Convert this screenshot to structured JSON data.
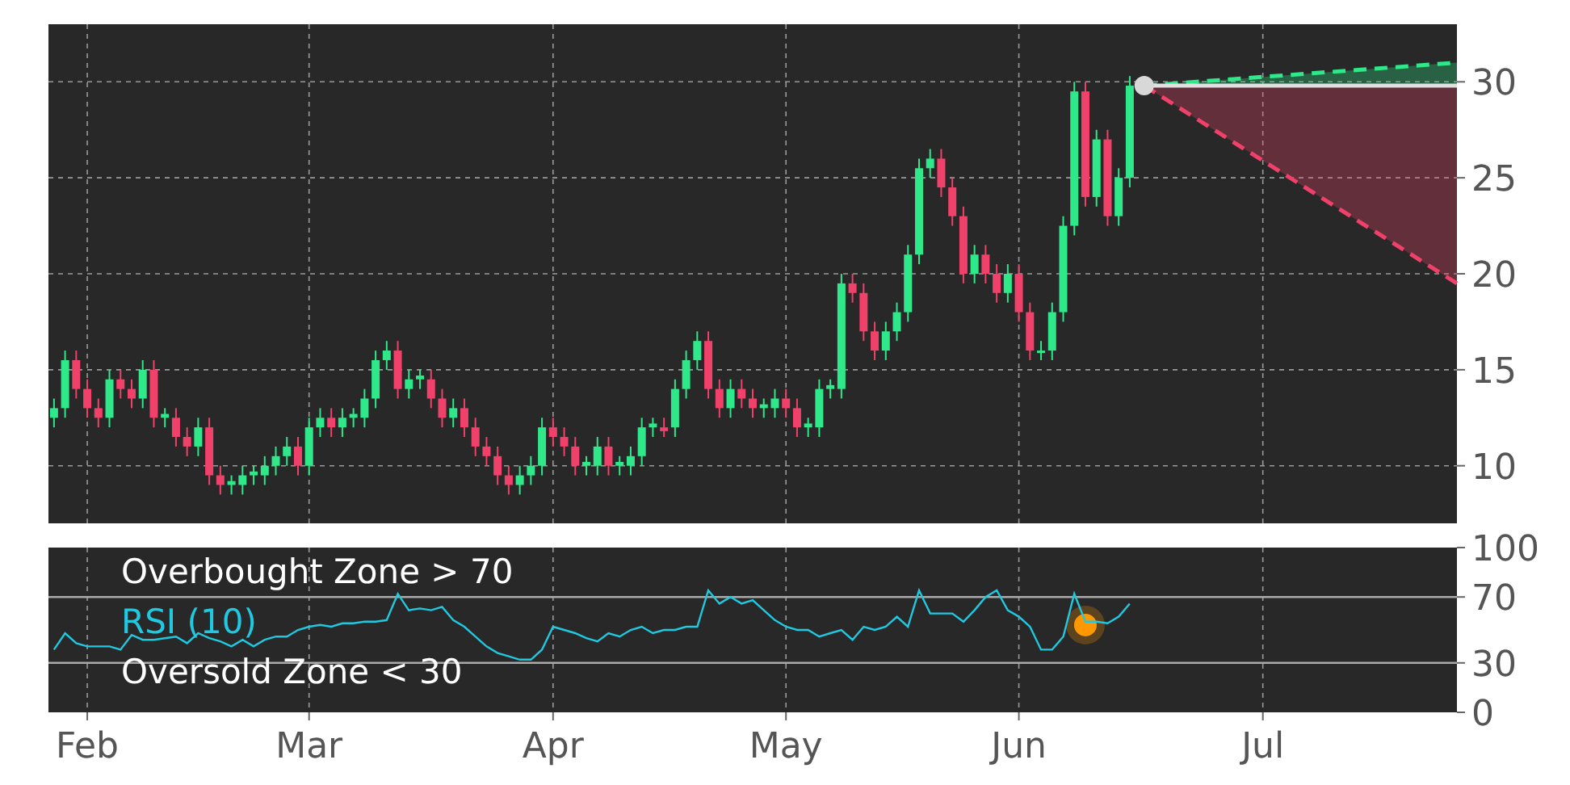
{
  "price_chart": {
    "chart_data": {
      "type": "candlestick",
      "grid": true,
      "ylim": [
        7,
        33
      ],
      "yticks": [
        {
          "value": 10,
          "label": "10"
        },
        {
          "value": 15,
          "label": "15"
        },
        {
          "value": 20,
          "label": "20"
        },
        {
          "value": 25,
          "label": "25"
        },
        {
          "value": 30,
          "label": "30"
        }
      ],
      "categories": [
        null,
        null,
        null,
        null,
        null,
        null,
        null,
        null,
        null,
        null,
        null,
        null,
        null,
        null,
        null,
        null,
        null,
        null,
        null,
        null,
        null,
        null,
        null,
        null,
        null,
        null,
        null,
        null,
        null,
        null,
        null,
        null,
        null,
        null,
        null,
        null,
        null,
        null,
        null,
        null,
        null,
        null,
        null,
        null,
        null,
        null,
        null,
        null,
        null,
        null,
        null,
        null,
        null,
        null,
        null,
        null,
        null,
        null,
        null,
        null,
        null,
        null,
        null,
        null,
        null,
        null,
        null,
        null,
        null,
        null,
        null,
        null,
        null,
        null,
        null,
        null,
        null,
        null,
        null,
        null,
        null,
        null,
        null,
        null,
        null,
        null,
        null,
        null,
        null,
        null,
        null,
        null,
        null,
        null,
        null,
        null,
        null,
        null,
        null,
        null,
        null,
        null,
        null,
        null,
        null,
        null,
        null,
        null,
        null,
        null,
        null,
        null,
        null,
        null,
        null,
        null,
        null,
        null,
        null,
        null,
        null,
        null,
        null,
        null,
        null,
        null,
        null
      ],
      "ohlc": [
        [
          12.5,
          13.5,
          12,
          13
        ],
        [
          13,
          16,
          12.5,
          15.5
        ],
        [
          15.5,
          16,
          13.5,
          14
        ],
        [
          14,
          14.5,
          12.5,
          13
        ],
        [
          13,
          13.5,
          12,
          12.5
        ],
        [
          12.5,
          15,
          12,
          14.5
        ],
        [
          14.5,
          15,
          13.5,
          14
        ],
        [
          14,
          14.5,
          13,
          13.5
        ],
        [
          13.5,
          15.5,
          13,
          15
        ],
        [
          15,
          15.5,
          12,
          12.5
        ],
        [
          12.5,
          13,
          12,
          12.7
        ],
        [
          12.5,
          13,
          11,
          11.5
        ],
        [
          11.5,
          12,
          10.5,
          11
        ],
        [
          11,
          12.5,
          10.5,
          12
        ],
        [
          12,
          12.5,
          9,
          9.5
        ],
        [
          9.5,
          10,
          8.5,
          9
        ],
        [
          9,
          9.5,
          8.5,
          9.2
        ],
        [
          9,
          10,
          8.5,
          9.5
        ],
        [
          9.5,
          10,
          9,
          9.7
        ],
        [
          9.5,
          10.5,
          9,
          10
        ],
        [
          10,
          11,
          9.5,
          10.5
        ],
        [
          10.5,
          11.5,
          10,
          11
        ],
        [
          11,
          11.5,
          9.5,
          10
        ],
        [
          10,
          12.5,
          9.5,
          12
        ],
        [
          12,
          13,
          11.5,
          12.5
        ],
        [
          12.5,
          13,
          11.5,
          12
        ],
        [
          12,
          13,
          11.5,
          12.5
        ],
        [
          12.5,
          13,
          12,
          12.7
        ],
        [
          12.5,
          14,
          12,
          13.5
        ],
        [
          13.5,
          16,
          13,
          15.5
        ],
        [
          15.5,
          16.5,
          15,
          16
        ],
        [
          16,
          16.5,
          13.5,
          14
        ],
        [
          14,
          15,
          13.5,
          14.5
        ],
        [
          14.5,
          15,
          14,
          14.7
        ],
        [
          14.5,
          15,
          13,
          13.5
        ],
        [
          13.5,
          14,
          12,
          12.5
        ],
        [
          12.5,
          13.5,
          12,
          13
        ],
        [
          13,
          13.5,
          11.5,
          12
        ],
        [
          12,
          12.5,
          10.5,
          11
        ],
        [
          11,
          11.5,
          10,
          10.5
        ],
        [
          10.5,
          11,
          9,
          9.5
        ],
        [
          9.5,
          10,
          8.5,
          9
        ],
        [
          9,
          10,
          8.5,
          9.5
        ],
        [
          9.5,
          10.5,
          9,
          10
        ],
        [
          10,
          12.5,
          9.5,
          12
        ],
        [
          12,
          12.5,
          11,
          11.5
        ],
        [
          11.5,
          12,
          10.5,
          11
        ],
        [
          11,
          11.5,
          9.5,
          10
        ],
        [
          10,
          10.5,
          9.5,
          10.2
        ],
        [
          10,
          11.5,
          9.5,
          11
        ],
        [
          11,
          11.5,
          9.5,
          10
        ],
        [
          10,
          10.5,
          9.5,
          10.2
        ],
        [
          10,
          11,
          9.5,
          10.5
        ],
        [
          10.5,
          12.5,
          10,
          12
        ],
        [
          12,
          12.5,
          11.5,
          12.2
        ],
        [
          12,
          12.5,
          11.5,
          11.8
        ],
        [
          12,
          14.5,
          11.5,
          14
        ],
        [
          14,
          16,
          13.5,
          15.5
        ],
        [
          15.5,
          17,
          15,
          16.5
        ],
        [
          16.5,
          17,
          13.5,
          14
        ],
        [
          14,
          14.5,
          12.5,
          13
        ],
        [
          13,
          14.5,
          12.5,
          14
        ],
        [
          14,
          14.5,
          13,
          13.5
        ],
        [
          13.5,
          14,
          12.5,
          13
        ],
        [
          13,
          13.5,
          12.5,
          13.2
        ],
        [
          13,
          14,
          12.5,
          13.5
        ],
        [
          13.5,
          14,
          12.5,
          13
        ],
        [
          13,
          13.5,
          11.5,
          12
        ],
        [
          12,
          12.5,
          11.5,
          12.2
        ],
        [
          12,
          14.5,
          11.5,
          14
        ],
        [
          14,
          14.5,
          13.5,
          14.2
        ],
        [
          14,
          20,
          13.5,
          19.5
        ],
        [
          19.5,
          20,
          18.5,
          19
        ],
        [
          19,
          19.5,
          16.5,
          17
        ],
        [
          17,
          17.5,
          15.5,
          16
        ],
        [
          16,
          17.5,
          15.5,
          17
        ],
        [
          17,
          18.5,
          16.5,
          18
        ],
        [
          18,
          21.5,
          17.5,
          21
        ],
        [
          21,
          26,
          20.5,
          25.5
        ],
        [
          25.5,
          26.5,
          25,
          26
        ],
        [
          26,
          26.5,
          24,
          24.5
        ],
        [
          24.5,
          25,
          22.5,
          23
        ],
        [
          23,
          23.5,
          19.5,
          20
        ],
        [
          20,
          21.5,
          19.5,
          21
        ],
        [
          21,
          21.5,
          19.5,
          20
        ],
        [
          20,
          20.5,
          18.5,
          19
        ],
        [
          19,
          20.5,
          18.5,
          20
        ],
        [
          20,
          20.5,
          17.5,
          18
        ],
        [
          18,
          18.5,
          15.5,
          16
        ],
        [
          16,
          16.5,
          15.5,
          16
        ],
        [
          16,
          18.5,
          15.5,
          18
        ],
        [
          18,
          23,
          17.5,
          22.5
        ],
        [
          22.5,
          30,
          22,
          29.5
        ],
        [
          29.5,
          30,
          23.5,
          24
        ],
        [
          24,
          27.5,
          23.5,
          27
        ],
        [
          27,
          27.5,
          22.5,
          23
        ],
        [
          23,
          25.5,
          22.5,
          25
        ],
        [
          25,
          30.3,
          24.5,
          29.8
        ],
        null,
        null,
        null,
        null,
        null,
        null,
        null,
        null,
        null,
        null,
        null,
        null,
        null,
        null,
        null,
        null,
        null,
        null,
        null,
        null,
        null,
        null,
        null,
        null,
        null,
        null,
        null,
        null,
        null
      ]
    }
  },
  "rsi_chart": {
    "zone_labels": [
      {
        "text": "Overbought Zone > 70"
      },
      {
        "text": "Oversold Zone < 30"
      }
    ],
    "chart_data": {
      "type": "line",
      "grid": true,
      "ylim": [
        0,
        100
      ],
      "yticks": [
        0,
        30,
        70,
        100
      ],
      "categories": [
        null,
        null,
        null,
        "Feb",
        null,
        null,
        null,
        null,
        null,
        null,
        null,
        null,
        null,
        null,
        null,
        null,
        null,
        null,
        null,
        null,
        null,
        null,
        null,
        "Mar",
        null,
        null,
        null,
        null,
        null,
        null,
        null,
        null,
        null,
        null,
        null,
        null,
        null,
        null,
        null,
        null,
        null,
        null,
        null,
        null,
        null,
        "Apr",
        null,
        null,
        null,
        null,
        null,
        null,
        null,
        null,
        null,
        null,
        null,
        null,
        null,
        null,
        null,
        null,
        null,
        null,
        null,
        null,
        "May",
        null,
        null,
        null,
        null,
        null,
        null,
        null,
        null,
        null,
        null,
        null,
        null,
        null,
        null,
        null,
        null,
        null,
        null,
        null,
        null,
        "Jun",
        null,
        null,
        null,
        null,
        null,
        null,
        null,
        null,
        null,
        null,
        null,
        null,
        null,
        null,
        null,
        null,
        null,
        null,
        null,
        null,
        null,
        "Jul",
        null,
        null,
        null,
        null,
        null,
        null,
        null,
        null,
        null,
        null,
        null,
        null,
        null,
        null,
        null,
        null,
        null
      ],
      "series": [
        {
          "name": "RSI (10)",
          "color": "#20c8e0",
          "values": [
            38,
            48,
            42,
            40,
            40,
            40,
            38,
            47,
            44,
            44,
            45,
            46,
            42,
            48,
            45,
            43,
            40,
            44,
            40,
            44,
            46,
            46,
            50,
            52,
            53,
            52,
            54,
            54,
            55,
            55,
            56,
            72,
            62,
            63,
            62,
            64,
            56,
            52,
            46,
            40,
            36,
            34,
            32,
            32,
            38,
            52,
            50,
            48,
            45,
            43,
            48,
            46,
            50,
            52,
            48,
            50,
            50,
            52,
            52,
            74,
            66,
            70,
            66,
            68,
            62,
            56,
            52,
            50,
            50,
            46,
            48,
            50,
            44,
            52,
            50,
            52,
            58,
            52,
            74,
            60,
            60,
            60,
            55,
            62,
            70,
            74,
            62,
            58,
            52,
            38,
            38,
            46,
            72,
            55,
            55,
            54,
            58,
            66,
            null,
            null,
            null,
            null,
            null,
            null,
            null,
            null,
            null,
            null,
            null,
            null,
            null,
            null,
            null,
            null,
            null,
            null,
            null,
            null,
            null,
            null,
            null,
            null,
            null,
            null,
            null,
            null,
            null
          ]
        }
      ]
    }
  }
}
